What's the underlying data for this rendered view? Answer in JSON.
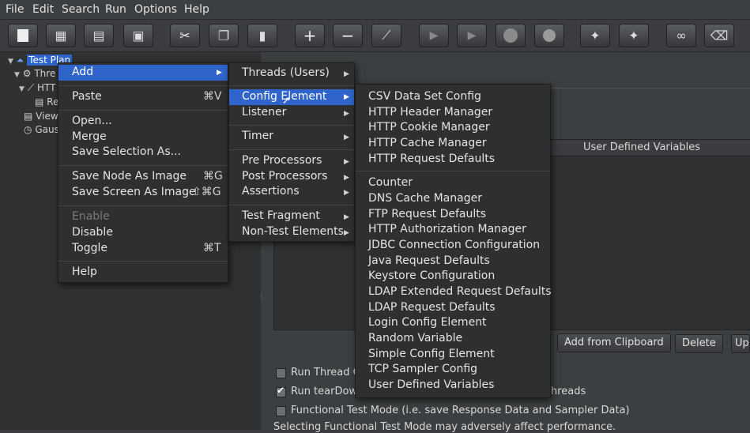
{
  "menubar": {
    "file": "File",
    "edit": "Edit",
    "search": "Search",
    "run": "Run",
    "options": "Options",
    "help": "Help"
  },
  "toolbar": {
    "icons": [
      "new-icon",
      "templates-icon",
      "open-icon",
      "save-icon",
      "cut-icon",
      "copy-icon",
      "paste-icon",
      "expand-icon",
      "collapse-icon",
      "toggle-icon",
      "start-icon",
      "start-no-pauses-icon",
      "stop-icon",
      "shutdown-icon",
      "clear-icon",
      "clear-all-icon",
      "search-icon",
      "reset-search-icon"
    ]
  },
  "tree": {
    "test_plan": "Test Plan",
    "thread_group": "Thre",
    "http": "HTT",
    "results": "Re",
    "view": "View",
    "gauss": "Gaus"
  },
  "context_menu": {
    "add": "Add",
    "paste": "Paste",
    "paste_sc": "⌘V",
    "open": "Open...",
    "merge": "Merge",
    "save_selection": "Save Selection As...",
    "save_node_image": "Save Node As Image",
    "save_node_image_sc": "⌘G",
    "save_screen_image": "Save Screen As Image",
    "save_screen_image_sc": "⇧⌘G",
    "enable": "Enable",
    "disable": "Disable",
    "toggle": "Toggle",
    "toggle_sc": "⌘T",
    "help": "Help"
  },
  "add_menu": {
    "threads": "Threads (Users)",
    "config_element": "Config Element",
    "listener": "Listener",
    "timer": "Timer",
    "pre_processors": "Pre Processors",
    "post_processors": "Post Processors",
    "assertions": "Assertions",
    "test_fragment": "Test Fragment",
    "non_test_elements": "Non-Test Elements"
  },
  "config_menu": {
    "items_group1": [
      "CSV Data Set Config",
      "HTTP Header Manager",
      "HTTP Cookie Manager",
      "HTTP Cache Manager",
      "HTTP Request Defaults"
    ],
    "items_group2": [
      "Counter",
      "DNS Cache Manager",
      "FTP Request Defaults",
      "HTTP Authorization Manager",
      "JDBC Connection Configuration",
      "Java Request Defaults",
      "Keystore Configuration",
      "LDAP Extended Request Defaults",
      "LDAP Request Defaults",
      "Login Config Element",
      "Random Variable",
      "Simple Config Element",
      "TCP Sampler Config",
      "User Defined Variables"
    ]
  },
  "panel": {
    "udv_header": "User Defined Variables",
    "add_from_clipboard": "Add from Clipboard",
    "delete": "Delete",
    "up": "Up",
    "run_thread_groups": "Run Thread G",
    "run_teardown": "Run tearDown",
    "run_teardown_tail": "hreads",
    "functional_mode": "Functional Test Mode (i.e. save Response Data and Sampler Data)",
    "functional_note": "Selecting Functional Test Mode may adversely affect performance."
  }
}
